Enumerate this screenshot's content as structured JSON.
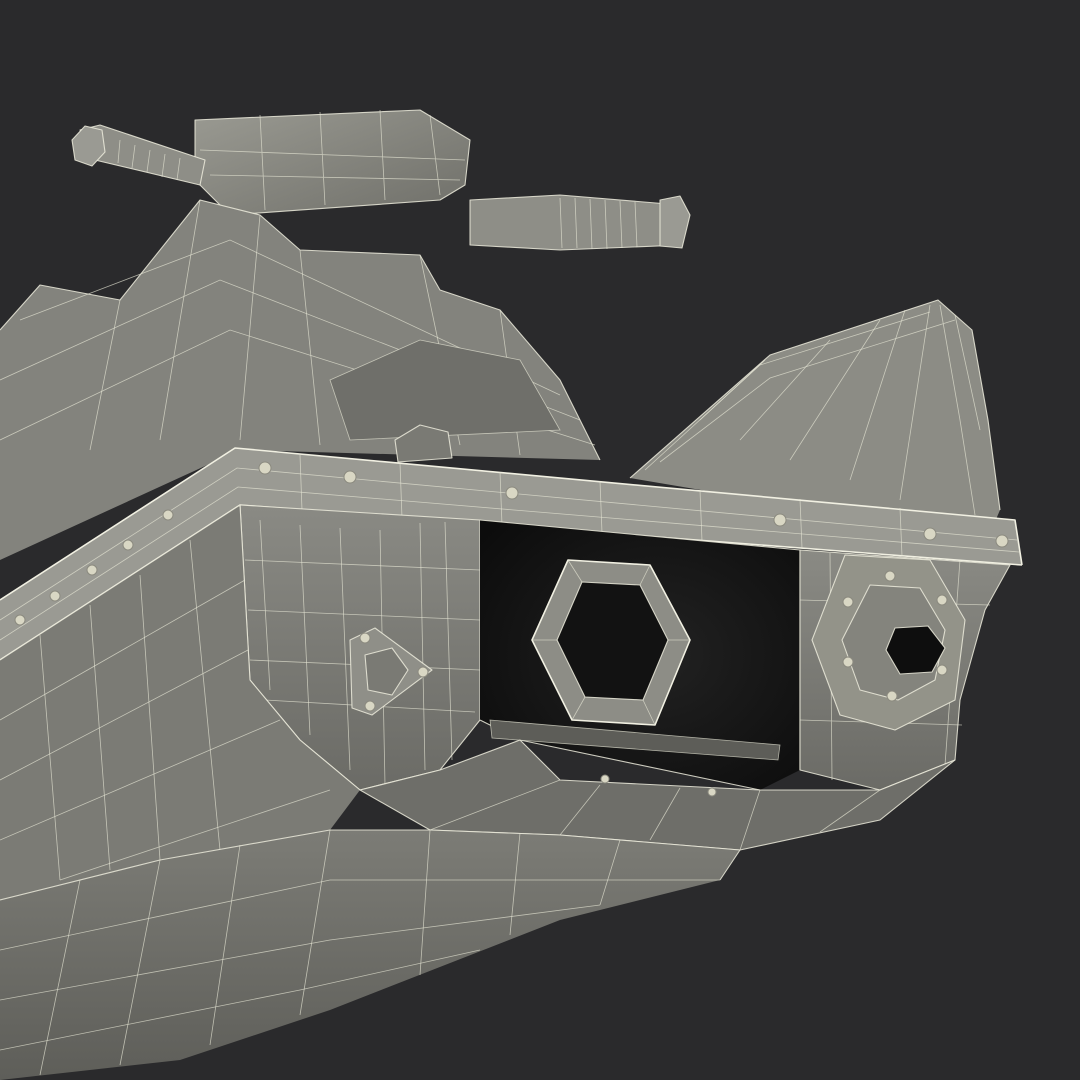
{
  "scene": {
    "subject": "jet-ski-hull-wireframe",
    "colors": {
      "background": "#2a2a2c",
      "hull_light": "#8d8d86",
      "hull_mid": "#75756f",
      "hull_dark": "#5c5c57",
      "cavity": "#111111",
      "wire": "#ecebdc"
    }
  }
}
